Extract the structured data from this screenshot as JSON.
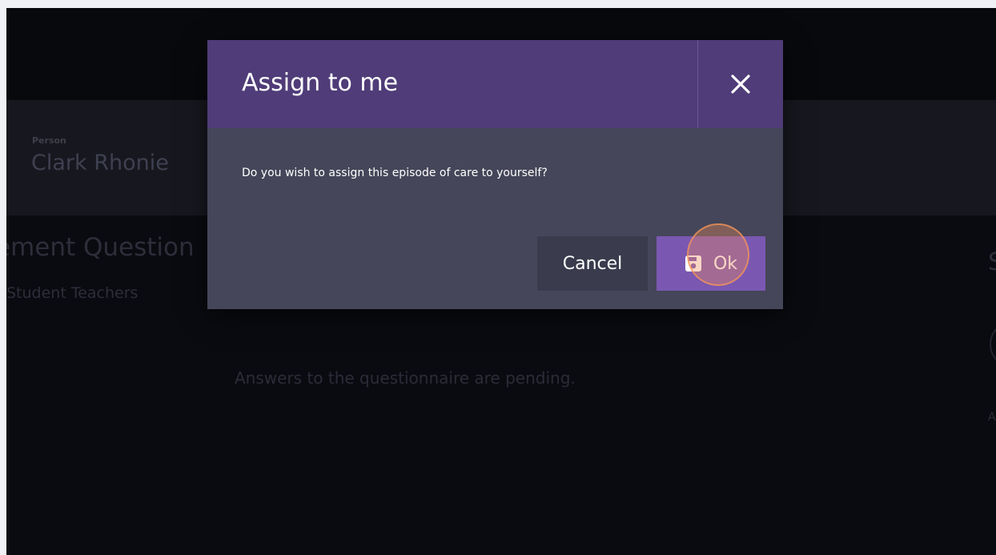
{
  "background": {
    "person": {
      "label": "Person",
      "name": "Clark Rhonie"
    },
    "questionnaire": {
      "title_partial": "ement Question",
      "subtitle_partial": "Student Teachers",
      "pending_text": "Answers to the questionnaire are pending."
    },
    "right_panel": {
      "heading_partial": "S",
      "text_partial": "A"
    }
  },
  "dialog": {
    "title": "Assign to me",
    "message": "Do you wish to assign this episode of care to yourself?",
    "cancel_label": "Cancel",
    "ok_label": "Ok",
    "close_icon": "close-icon",
    "ok_icon": "save-icon"
  },
  "colors": {
    "header": "#4f3c78",
    "body": "#454659",
    "ok_button": "#7a58b2",
    "cancel_button": "#3a3b4c"
  }
}
